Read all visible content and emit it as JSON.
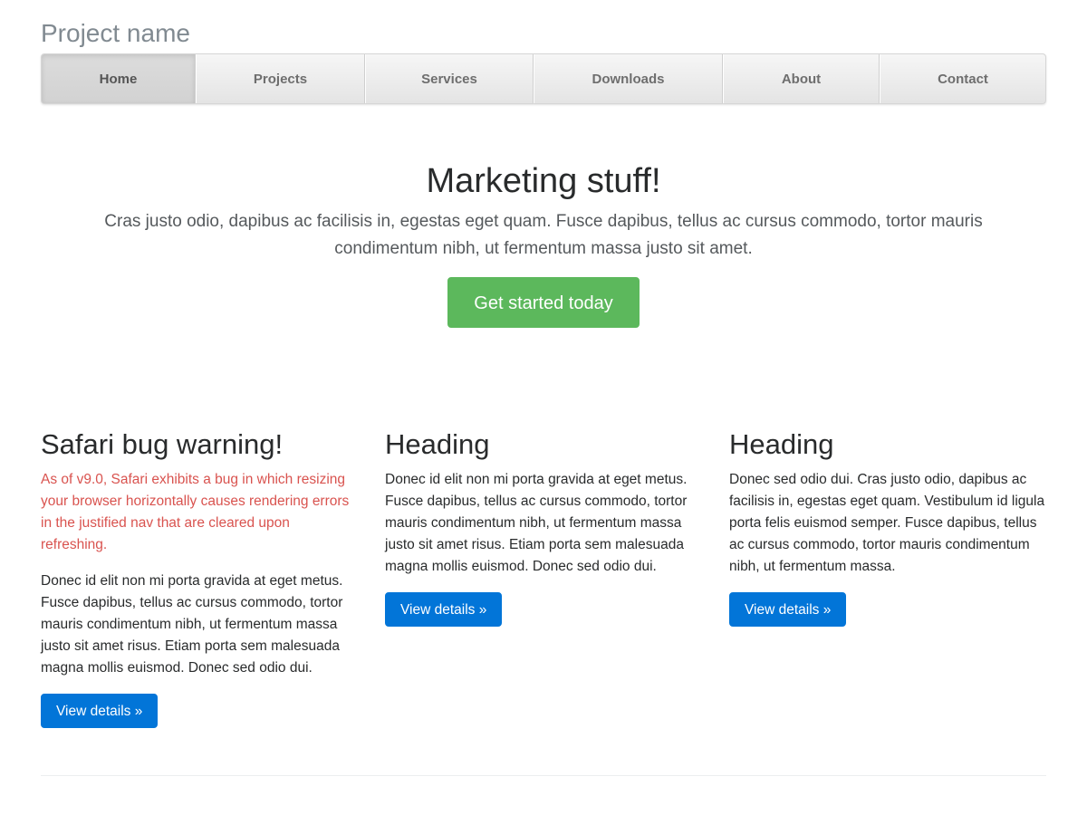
{
  "header": {
    "project_name": "Project name"
  },
  "nav": {
    "items": [
      {
        "label": "Home",
        "active": true
      },
      {
        "label": "Projects"
      },
      {
        "label": "Services"
      },
      {
        "label": "Downloads"
      },
      {
        "label": "About"
      },
      {
        "label": "Contact"
      }
    ]
  },
  "hero": {
    "title": "Marketing stuff!",
    "lead": "Cras justo odio, dapibus ac facilisis in, egestas eget quam. Fusce dapibus, tellus ac cursus commodo, tortor mauris condimentum nibh, ut fermentum massa justo sit amet.",
    "cta_label": "Get started today"
  },
  "columns": [
    {
      "heading": "Safari bug warning!",
      "warning": "As of v9.0, Safari exhibits a bug in which resizing your browser horizontally causes rendering errors in the justified nav that are cleared upon refreshing.",
      "body": "Donec id elit non mi porta gravida at eget metus. Fusce dapibus, tellus ac cursus commodo, tortor mauris condimentum nibh, ut fermentum massa justo sit amet risus. Etiam porta sem malesuada magna mollis euismod. Donec sed odio dui.",
      "button_label": "View details »"
    },
    {
      "heading": "Heading",
      "body": "Donec id elit non mi porta gravida at eget metus. Fusce dapibus, tellus ac cursus commodo, tortor mauris condimentum nibh, ut fermentum massa justo sit amet risus. Etiam porta sem malesuada magna mollis euismod. Donec sed odio dui.",
      "button_label": "View details »"
    },
    {
      "heading": "Heading",
      "body": "Donec sed odio dui. Cras justo odio, dapibus ac facilisis in, egestas eget quam. Vestibulum id ligula porta felis euismod semper. Fusce dapibus, tellus ac cursus commodo, tortor mauris condimentum nibh, ut fermentum massa.",
      "button_label": "View details »"
    }
  ],
  "colors": {
    "success": "#5cb85c",
    "primary": "#0275d8",
    "danger": "#d9534f",
    "muted": "#818a91"
  }
}
